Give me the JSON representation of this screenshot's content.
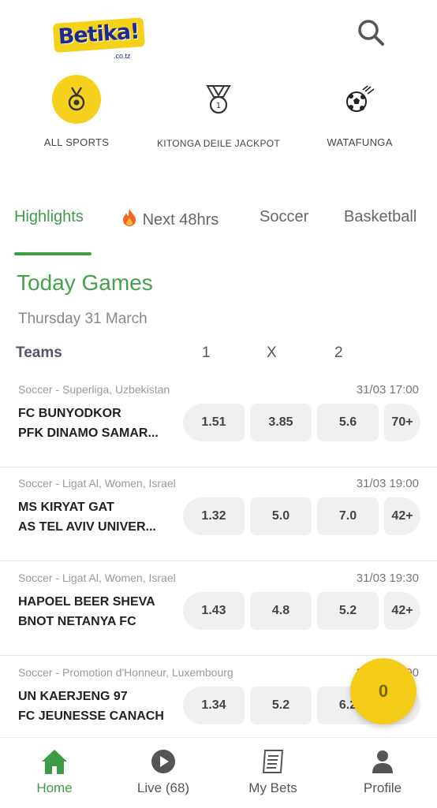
{
  "header": {
    "logo_text": "Betika!",
    "logo_sub": ".co.tz"
  },
  "categories": [
    {
      "label": "ALL SPORTS",
      "icon": "medal-icon",
      "active": true
    },
    {
      "label": "KITONGA DEILE JACKPOT",
      "icon": "award-icon",
      "active": false
    },
    {
      "label": "WATAFUNGA",
      "icon": "soccer-ball-icon",
      "active": false
    }
  ],
  "tabs": [
    {
      "label": "Highlights"
    },
    {
      "label": "Next 48hrs"
    },
    {
      "label": "Soccer"
    },
    {
      "label": "Basketball"
    }
  ],
  "section": {
    "title": "Today Games",
    "date": "Thursday 31 March"
  },
  "columns": {
    "teams": "Teams",
    "one": "1",
    "x": "X",
    "two": "2"
  },
  "matches": [
    {
      "league": "Soccer - Superliga, Uzbekistan",
      "time": "31/03 17:00",
      "home": "FC BUNYODKOR",
      "away": "PFK DINAMO SAMAR...",
      "odd1": "1.51",
      "oddx": "3.85",
      "odd2": "5.6",
      "more": "70+"
    },
    {
      "league": "Soccer - Ligat Al, Women, Israel",
      "time": "31/03 19:00",
      "home": "MS KIRYAT GAT",
      "away": "AS TEL AVIV UNIVER...",
      "odd1": "1.32",
      "oddx": "5.0",
      "odd2": "7.0",
      "more": "42+"
    },
    {
      "league": "Soccer - Ligat Al, Women, Israel",
      "time": "31/03 19:30",
      "home": "HAPOEL BEER SHEVA",
      "away": "BNOT NETANYA FC",
      "odd1": "1.43",
      "oddx": "4.8",
      "odd2": "5.2",
      "more": "42+"
    },
    {
      "league": "Soccer - Promotion d'Honneur, Luxembourg",
      "time": "31/03 20:00",
      "home": "UN KAERJENG 97",
      "away": "FC JEUNESSE CANACH",
      "odd1": "1.34",
      "oddx": "5.2",
      "odd2": "6.2",
      "more": ""
    }
  ],
  "betslip": {
    "count": "0"
  },
  "bottom_nav": [
    {
      "label": "Home",
      "icon": "home-icon",
      "active": true
    },
    {
      "label": "Live (68)",
      "icon": "play-icon",
      "active": false
    },
    {
      "label": "My Bets",
      "icon": "receipt-icon",
      "active": false
    },
    {
      "label": "Profile",
      "icon": "person-icon",
      "active": false
    }
  ],
  "colors": {
    "accent": "#3e9c46",
    "brand_yellow": "#f7cf1d",
    "brand_blue": "#1e2a8f"
  }
}
